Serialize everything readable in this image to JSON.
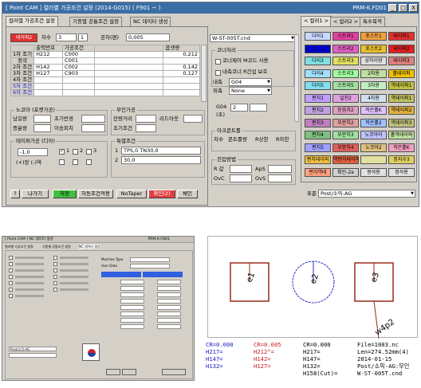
{
  "window": {
    "title": "[ Point CAM ]  컬러별 가공조건 설정   (2014-G015)    ( F901 ~ )",
    "right_title": "PRM-K.FD01",
    "buttons": [
      "_",
      "□",
      "X"
    ]
  },
  "tabs": [
    "컬러별 가공조건 설정",
    "기종별 공통조건 설정",
    "NC 데이터 생성"
  ],
  "color_header": {
    "label": "테이퍼2",
    "rev_label": "차수",
    "rev_value": "3",
    "rev_value2": "1",
    "gap_label": "공차(편)",
    "gap_value": "0,005"
  },
  "cond_table": {
    "headers": [
      "",
      "출력번호",
      "가공조건",
      "",
      "옵셋량"
    ],
    "rows": [
      [
        "1차 조기",
        "H212",
        "C000",
        "",
        "0,212"
      ],
      [
        "정삭",
        "",
        "C001",
        "",
        ""
      ],
      [
        "2차 조건",
        "H142",
        "C002",
        "",
        "0,142"
      ],
      [
        "3차 조건",
        "H127",
        "C903",
        "",
        "0,127"
      ],
      [
        "4차 조건",
        "",
        "",
        "",
        ""
      ],
      [
        "5차 조건",
        "",
        "",
        "",
        ""
      ],
      [
        "6차 조건",
        "",
        "",
        "",
        ""
      ]
    ]
  },
  "nozzle": {
    "title": "노코아 (포켓가공)",
    "labels": [
      "남길량",
      "초기반경",
      "증분량",
      "이송피치"
    ]
  },
  "nomachine": {
    "title": "무인가공",
    "labels": [
      "잔량거리",
      "리드아웃",
      "초기조건"
    ]
  },
  "taper": {
    "title": "테이퍼가공 (디아)",
    "value": "-1,0",
    "plus": "(+)장 (-)역",
    "opts": [
      "1",
      "2",
      "3"
    ]
  },
  "special": {
    "title": "특별조건",
    "rows": [
      [
        "1",
        "TPS,0 TN30,0"
      ],
      [
        "2",
        "30,0"
      ]
    ]
  },
  "bottom_buttons": [
    "?",
    "나가기",
    "저장",
    "자동조건적용",
    "NoTaper",
    "확인(2)",
    "채인"
  ],
  "file_select": "W-ST-005T.cnd",
  "corner": {
    "title": "코너처리",
    "opt1": "코너제어 M코드 사용",
    "opt2": "내측코너 R간섭 보호"
  },
  "inner": {
    "label": "내측",
    "value": "G04",
    "outer_label": "외측",
    "outer_value": "None"
  },
  "g04": {
    "label": "G04",
    "sub": "(초)",
    "value": "2"
  },
  "arch": {
    "title": "아크콘트롤",
    "labels": [
      "차수",
      "콘트롤량",
      "R상한",
      "R하한"
    ]
  },
  "entry": {
    "title": "진입방법",
    "labels": [
      "R 값",
      "ApS",
      "OvC",
      "OvS"
    ]
  },
  "color_tabs": [
    "< 컬러1 >",
    "< 컬러2 >",
    "특수목적"
  ],
  "color_grid": [
    [
      {
        "t": "다이1",
        "c": "#c8d8ff"
      },
      {
        "t": "스트리1",
        "c": "#e040a0"
      },
      {
        "t": "포스트1",
        "c": "#f0a040"
      },
      {
        "t": "테이퍼1",
        "c": "#e03030"
      }
    ],
    [
      {
        "t": "",
        "c": "#0000c0"
      },
      {
        "t": "스트리2",
        "c": "#e060c0"
      },
      {
        "t": "포스트2",
        "c": "#e8c030"
      },
      {
        "t": "테이퍼2",
        "c": "#e02020"
      }
    ],
    [
      {
        "t": "다이3",
        "c": "#80e0e0"
      },
      {
        "t": "스트리3",
        "c": "#e0e060"
      },
      {
        "t": "상하이량",
        "c": "#e0e0e0"
      },
      {
        "t": "테이퍼3",
        "c": "#e08080"
      }
    ],
    [
      {
        "t": "다이4",
        "c": "#a0e0ff"
      },
      {
        "t": "스트리3",
        "c": "#a0ffa0"
      },
      {
        "t": "2차용",
        "c": "#c0e0a0"
      },
      {
        "t": "홀테이퍼",
        "c": "#f0c000"
      }
    ],
    [
      {
        "t": "다이5",
        "c": "#80e0f0"
      },
      {
        "t": "스트리5",
        "c": "#a0e0a0"
      },
      {
        "t": "3차용",
        "c": "#c0f0c0"
      },
      {
        "t": "역테이퍼1",
        "c": "#c0c040"
      }
    ],
    [
      {
        "t": "편치1",
        "c": "#c0a0ff"
      },
      {
        "t": "일천2",
        "c": "#e0a0e0"
      },
      {
        "t": "4차용",
        "c": "#d0e0f0"
      },
      {
        "t": "역테이퍼1",
        "c": "#c0c060"
      }
    ],
    [
      {
        "t": "편치2",
        "c": "#c0a0e0"
      },
      {
        "t": "믿음치2",
        "c": "#e0a0c0"
      },
      {
        "t": "작은홀K",
        "c": "#e0c0ff"
      },
      {
        "t": "역테이퍼2",
        "c": "#e0b040"
      }
    ],
    [
      {
        "t": "편치3",
        "c": "#c080c0"
      },
      {
        "t": "부분치2",
        "c": "#e0a0a0"
      },
      {
        "t": "작은홀2",
        "c": "#a0c0ff"
      },
      {
        "t": "역테이퍼3",
        "c": "#c0c080"
      }
    ],
    [
      {
        "t": "편치4",
        "c": "#80c080"
      },
      {
        "t": "부분치3",
        "c": "#a0e0a0"
      },
      {
        "t": "노코아이",
        "c": "#c0c0ff"
      },
      {
        "t": "홀역테이퍼",
        "c": "#c0e0a0"
      }
    ],
    [
      {
        "t": "편치5",
        "c": "#a0a0ff"
      },
      {
        "t": "부분치4",
        "c": "#e06060"
      },
      {
        "t": "노코아2",
        "c": "#e0c080"
      },
      {
        "t": "작은홀K",
        "c": "#f0a0c0"
      }
    ],
    [
      {
        "t": "편치테이퍼",
        "c": "#f0c040"
      },
      {
        "t": "역편치테이퍼",
        "c": "#e06040"
      },
      {
        "t": "",
        "c": "#e0e0a0"
      },
      {
        "t": "정지수3",
        "c": "#e0d060"
      }
    ],
    [
      {
        "t": "편치역테",
        "c": "#ffa080"
      },
      {
        "t": "확인-2a",
        "c": "#d0d0d0"
      },
      {
        "t": "왕삭용",
        "c": "#e0e0e0"
      },
      {
        "t": "정삭용",
        "c": "#e0e0e0"
      }
    ]
  ],
  "post_select": {
    "label": "표준",
    "value": "Post/소믹-AG"
  },
  "thumbnail": {
    "title": "[ Point CAM ] NC 데이터 생성",
    "right": "PRM-K.FD01",
    "post": "Post/소믹-AG",
    "machine_label": "Machine Type",
    "file_label": "User Data",
    "side_tab": "NC 데이터 생성"
  },
  "drawing": {
    "labels": [
      "e1",
      "e2",
      "e3",
      "w4p2"
    ]
  },
  "legend": {
    "col1": [
      "CR=0.000",
      "H217=",
      "H147=",
      "H132="
    ],
    "col2": [
      "CR=0.005",
      "H212°=",
      "H142=",
      "H127="
    ],
    "col3": [
      "CR=0.000",
      "H217=",
      "H147=",
      "H132=",
      "H158(Cut)="
    ],
    "col4": [
      "File=1003.nc",
      "Len=274.52mm(4)",
      "2014-01-15",
      "Post/소믹-AG:무인",
      "W-ST-005T.cnd"
    ]
  }
}
